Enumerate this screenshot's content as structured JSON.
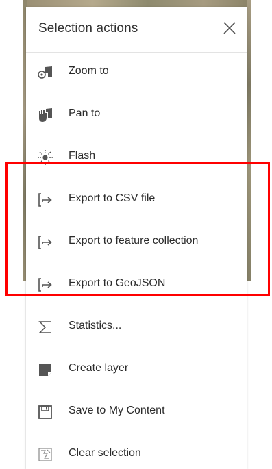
{
  "panel": {
    "title": "Selection actions",
    "close_icon": "close-icon"
  },
  "menu": {
    "items": [
      {
        "label": "Zoom to",
        "icon": "zoom-to-icon"
      },
      {
        "label": "Pan to",
        "icon": "pan-to-icon"
      },
      {
        "label": "Flash",
        "icon": "flash-icon"
      },
      {
        "label": "Export to CSV file",
        "icon": "export-icon"
      },
      {
        "label": "Export to feature collection",
        "icon": "export-icon"
      },
      {
        "label": "Export to GeoJSON",
        "icon": "export-icon"
      },
      {
        "label": "Statistics...",
        "icon": "sigma-icon"
      },
      {
        "label": "Create layer",
        "icon": "create-layer-icon"
      },
      {
        "label": "Save to My Content",
        "icon": "save-icon"
      },
      {
        "label": "Clear selection",
        "icon": "clear-selection-icon"
      }
    ]
  },
  "colors": {
    "highlight": "#ff0000",
    "text": "#2b2b2b",
    "icon": "#555555"
  }
}
